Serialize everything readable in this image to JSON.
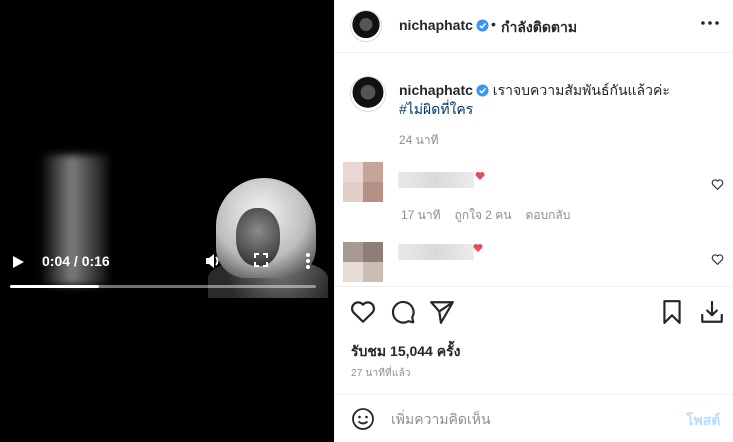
{
  "video": {
    "time_display": "0:04 / 0:16",
    "progress_fraction": 0.29
  },
  "header": {
    "username": "nichaphatc",
    "separator": "•",
    "follow_status": "กำลังติดตาม"
  },
  "caption": {
    "username": "nichaphatc",
    "text": "เราจบความสัมพันธ์กันแล้วค่ะ",
    "hashtag": "#ไม่ผิดที่ใคร",
    "age": "24 นาที"
  },
  "comments": [
    {
      "age": "17 นาที",
      "likes": "ถูกใจ 2 คน",
      "reply": "ตอบกลับ"
    },
    {
      "age": "",
      "likes": "",
      "reply": ""
    }
  ],
  "stats": {
    "views": "รับชม 15,044 ครั้ง",
    "posted_ago": "27 นาทีที่แล้ว"
  },
  "composer": {
    "placeholder": "เพิ่มความคิดเห็น",
    "post_label": "โพสต์"
  },
  "colors": {
    "verified": "#3897f0",
    "link": "#00376b",
    "post_disabled": "#b2dffc",
    "heart": "#ed4956"
  },
  "icons": [
    "play-icon",
    "volume-icon",
    "fullscreen-icon",
    "more-vert-icon",
    "verified-icon",
    "more-horiz-icon",
    "heart-icon",
    "comment-icon",
    "share-icon",
    "bookmark-icon",
    "download-icon",
    "emoji-icon"
  ]
}
